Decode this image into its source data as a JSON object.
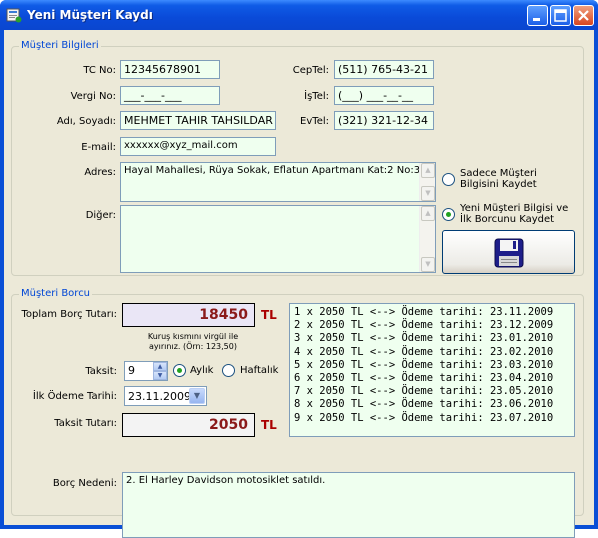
{
  "window": {
    "title": "Yeni Müşteri Kaydı"
  },
  "customer_group": {
    "title": "Müşteri Bilgileri",
    "tc_label": "TC No:",
    "tc_value": "12345678901",
    "vergi_label": "Vergi No:",
    "vergi_value": "___-___-___",
    "name_label": "Adı, Soyadı:",
    "name_value": "MEHMET TAHIR TAHSILDAR",
    "email_label": "E-mail:",
    "email_value": "xxxxxx@xyz_mail.com",
    "adres_label": "Adres:",
    "adres_value": "Hayal Mahallesi, Rüya Sokak, Eflatun Apartmanı Kat:2 No:3",
    "diger_label": "Diğer:",
    "diger_value": "",
    "ceptel_label": "CepTel:",
    "ceptel_value": "(511) 765-43-21",
    "istel_label": "İşTel:",
    "istel_value": "(___) ___-__-__",
    "evtel_label": "EvTel:",
    "evtel_value": "(321) 321-12-34",
    "option_only": "Sadece Müşteri Bilgisini Kaydet",
    "option_with_debt": "Yeni Müşteri Bilgisi ve İlk Borcunu Kaydet",
    "selected_option": "option_with_debt",
    "save_icon": "floppy-disk-icon"
  },
  "debt_group": {
    "title": "Müşteri Borcu",
    "total_label": "Toplam Borç Tutarı:",
    "total_value": "18450",
    "currency": "TL",
    "hint": "Kuruş kısmını virgül ile ayırınız. (Örn: 123,50)",
    "taksit_label": "Taksit:",
    "taksit_value": "9",
    "period_monthly": "Aylık",
    "period_weekly": "Haftalık",
    "selected_period": "monthly",
    "first_payment_label": "İlk Ödeme Tarihi:",
    "first_payment_value": "23.11.2009",
    "installment_label": "Taksit Tutarı:",
    "installment_value": "2050",
    "reason_label": "Borç Nedeni:",
    "reason_value": "2. El Harley Davidson motosiklet satıldı.",
    "schedule": [
      "1 x 2050 TL <--> Ödeme tarihi: 23.11.2009",
      "2 x 2050 TL <--> Ödeme tarihi: 23.12.2009",
      "3 x 2050 TL <--> Ödeme tarihi: 23.01.2010",
      "4 x 2050 TL <--> Ödeme tarihi: 23.02.2010",
      "5 x 2050 TL <--> Ödeme tarihi: 23.03.2010",
      "6 x 2050 TL <--> Ödeme tarihi: 23.04.2010",
      "7 x 2050 TL <--> Ödeme tarihi: 23.05.2010",
      "8 x 2050 TL <--> Ödeme tarihi: 23.06.2010",
      "9 x 2050 TL <--> Ödeme tarihi: 23.07.2010"
    ]
  }
}
